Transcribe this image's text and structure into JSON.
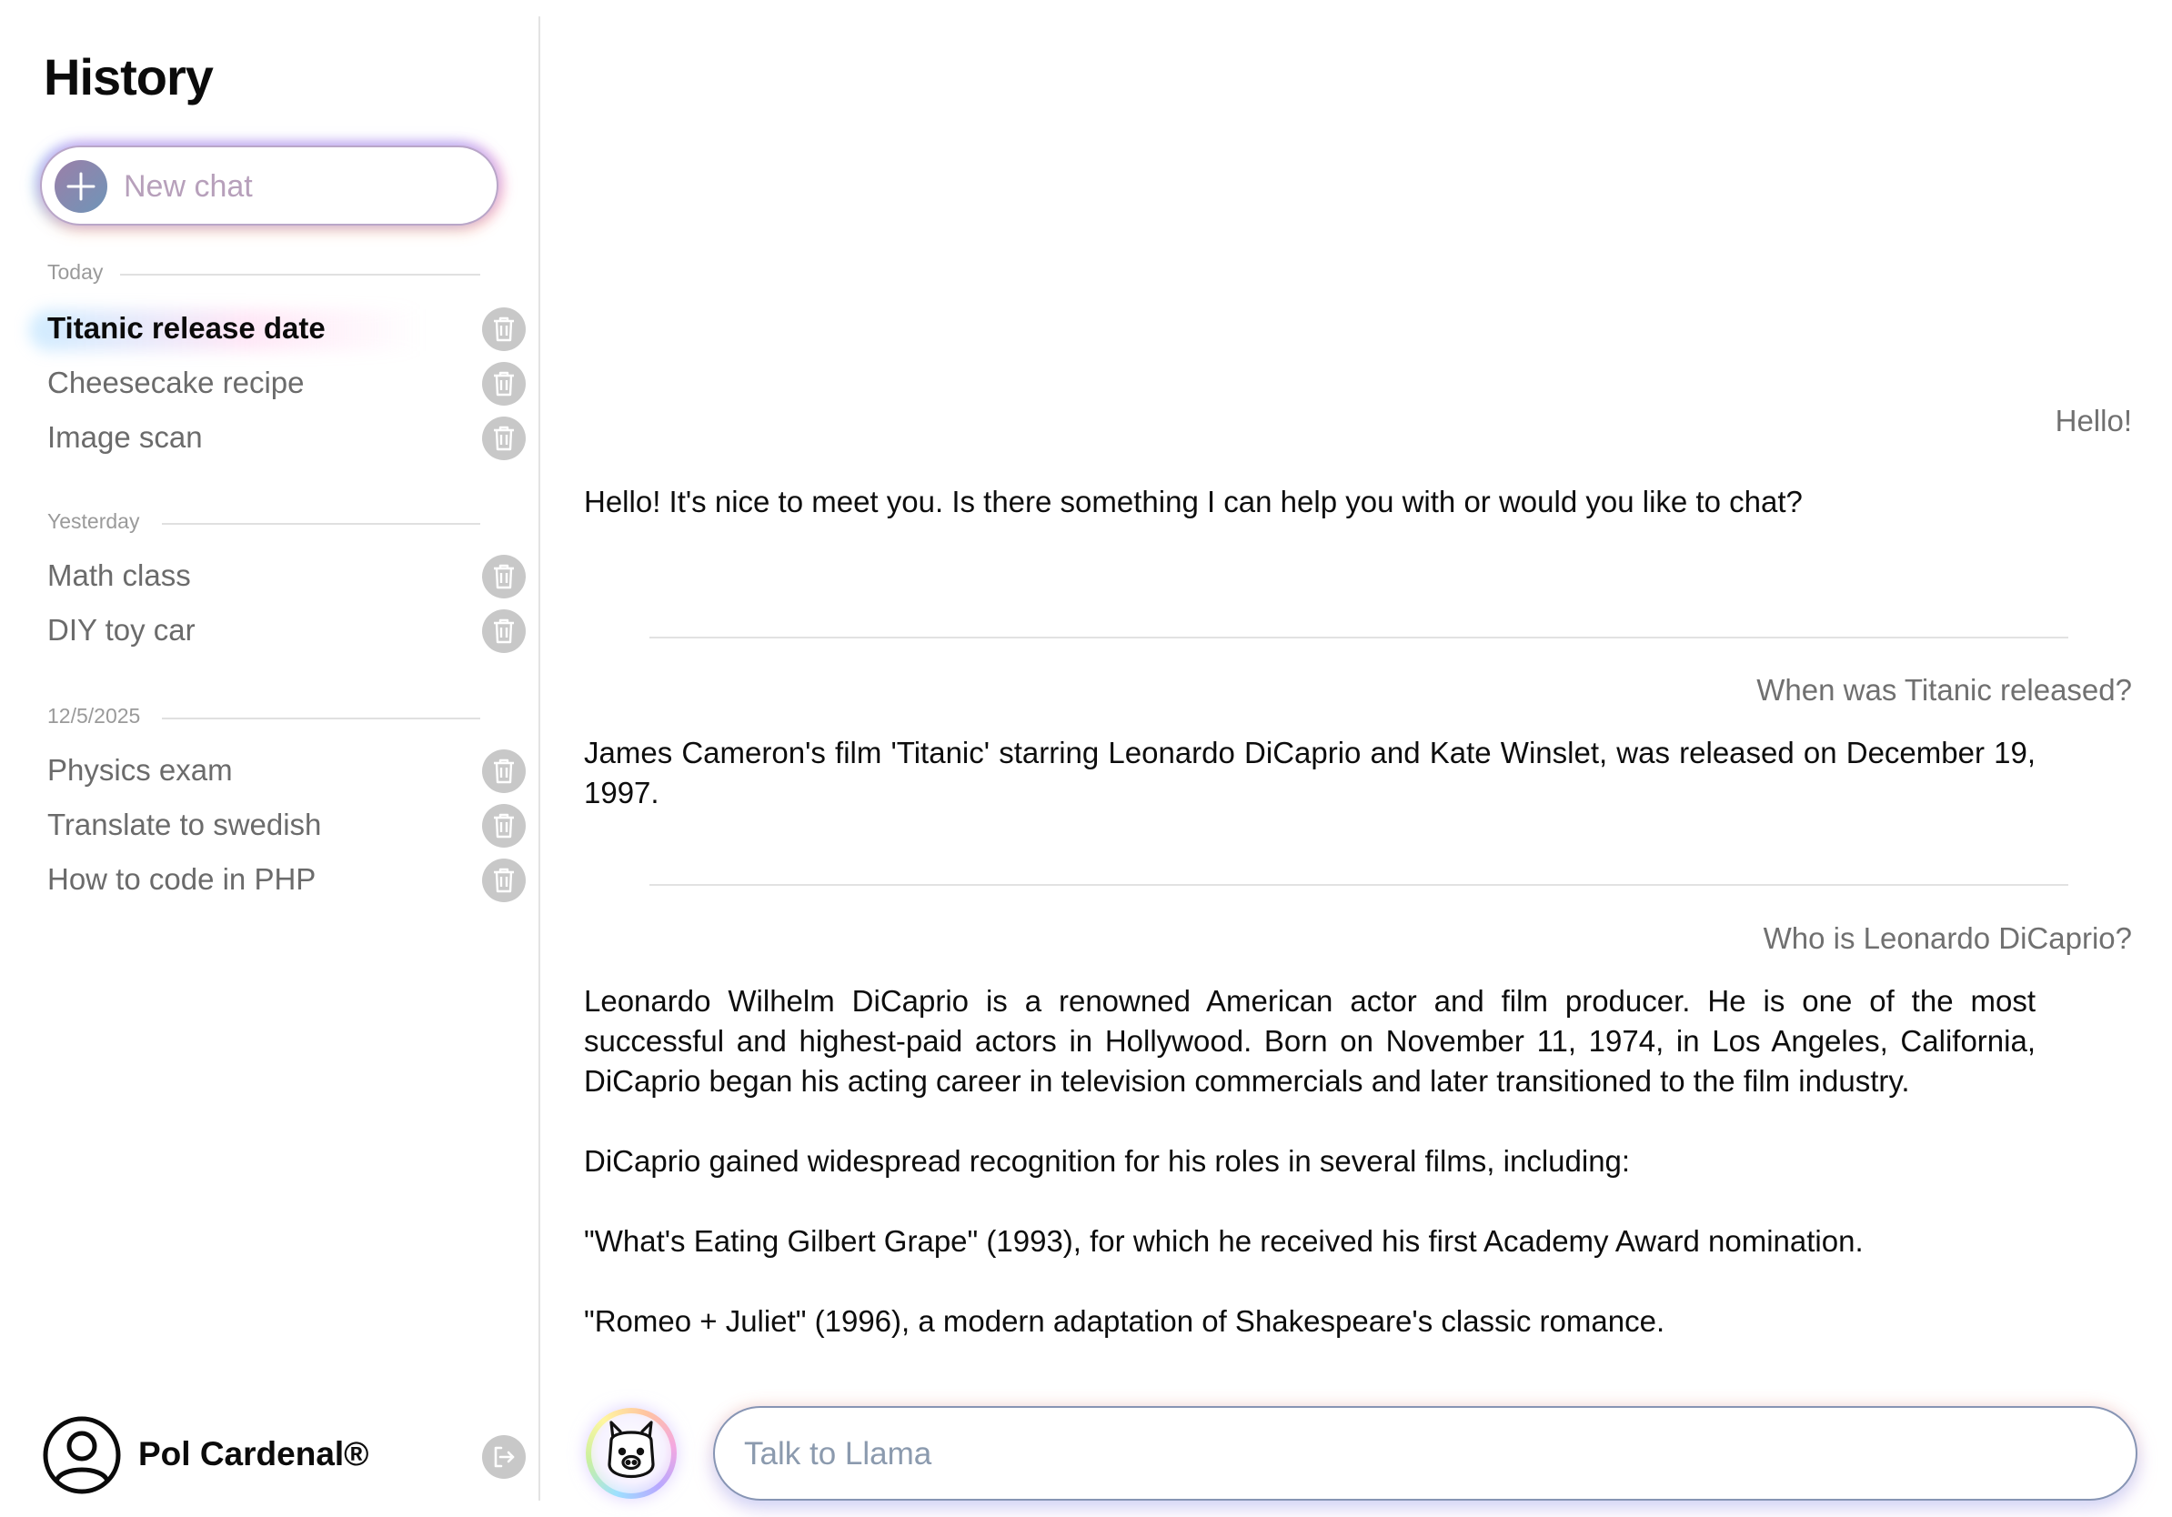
{
  "sidebar": {
    "title": "History",
    "new_chat_label": "New chat",
    "groups": [
      {
        "label": "Today",
        "items": [
          {
            "label": "Titanic release date",
            "active": true
          },
          {
            "label": "Cheesecake recipe"
          },
          {
            "label": "Image scan"
          }
        ]
      },
      {
        "label": "Yesterday",
        "items": [
          {
            "label": "Math class"
          },
          {
            "label": "DIY toy car"
          }
        ]
      },
      {
        "label": "12/5/2025",
        "items": [
          {
            "label": "Physics exam"
          },
          {
            "label": "Translate to swedish"
          },
          {
            "label": "How to code in PHP"
          }
        ]
      }
    ],
    "user": {
      "name": "Pol Cardenal®"
    }
  },
  "chat": {
    "messages": [
      {
        "role": "user",
        "text": "Hello!"
      },
      {
        "role": "assistant",
        "paragraphs": [
          "Hello! It's nice to meet you. Is there something I can help you with or would you like to chat?"
        ]
      },
      {
        "role": "user",
        "text": "When was Titanic released?"
      },
      {
        "role": "assistant",
        "paragraphs": [
          "James Cameron's film 'Titanic' starring Leonardo DiCaprio and Kate Winslet, was released on December 19, 1997."
        ]
      },
      {
        "role": "user",
        "text": "Who is Leonardo DiCaprio?"
      },
      {
        "role": "assistant",
        "paragraphs": [
          "Leonardo Wilhelm DiCaprio is a renowned American actor and film producer. He is one of the most successful and highest-paid actors in Hollywood. Born on November 11, 1974, in Los Angeles, California, DiCaprio began his acting career in television commercials and later transitioned to the film industry.",
          "DiCaprio gained widespread recognition for his roles in several films, including:",
          "\"What's Eating Gilbert Grape\" (1993), for which he received his first Academy Award nomination.",
          "\"Romeo + Juliet\" (1996), a modern adaptation of Shakespeare's classic romance."
        ]
      }
    ]
  },
  "composer": {
    "placeholder": "Talk to Llama",
    "value": ""
  },
  "icons": {
    "new_chat": "plus-icon",
    "delete": "trash-icon",
    "user": "user-circle-icon",
    "logout": "logout-icon",
    "assistant": "llama-icon"
  },
  "colors": {
    "accent_border": "#8795b4",
    "new_chat_text": "#b7a0bb",
    "icon_gray": "#c8c8c8"
  }
}
